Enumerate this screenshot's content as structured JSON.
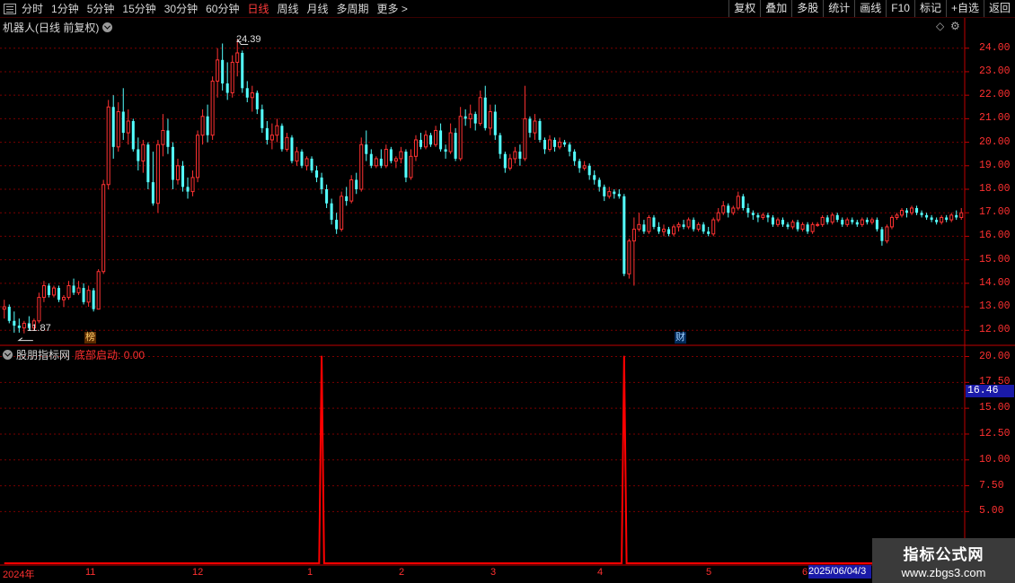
{
  "toolbar": {
    "tabs": [
      "分时",
      "1分钟",
      "5分钟",
      "15分钟",
      "30分钟",
      "60分钟",
      "日线",
      "周线",
      "月线",
      "多周期",
      "更多 >"
    ],
    "active_index": 6,
    "buttons": [
      "复权",
      "叠加",
      "多股",
      "统计",
      "画线",
      "F10",
      "标记",
      "+自选",
      "返回"
    ]
  },
  "main_panel": {
    "title": "机器人(日线 前复权)",
    "high_label": "24.39",
    "low_label": "11.87",
    "tag_bang": "榜",
    "tag_cai": "财",
    "axis_labels": [
      "24.00",
      "23.00",
      "22.00",
      "21.00",
      "20.00",
      "19.00",
      "18.00",
      "17.00",
      "16.00",
      "15.00",
      "14.00",
      "13.00",
      "12.00"
    ]
  },
  "indicator_panel": {
    "source": "股朋指标网",
    "indicator_name": "底部启动",
    "indicator_value": "0.00",
    "current_price_tag": "16.46",
    "axis_labels": [
      "20.00",
      "17.50",
      "15.00",
      "12.50",
      "10.00",
      "7.50",
      "5.00"
    ]
  },
  "date_axis": {
    "labels": [
      "2024年",
      "11",
      "12",
      "1",
      "2",
      "3",
      "4",
      "5",
      "6"
    ],
    "cursor_date": "2025/06/04/3"
  },
  "watermark": {
    "line1": "指标公式网",
    "line2": "www.zbgs3.com"
  },
  "colors": {
    "up": "#ff3232",
    "down": "#54ffff",
    "axis": "#c00000",
    "grid": "#7a0000",
    "signal": "#ff0000"
  },
  "chart_data": {
    "type": "candlestick",
    "price_range": [
      11.4,
      24.6
    ],
    "indicator_range": [
      0,
      21
    ],
    "signal_peaks": [
      {
        "position": "between 12 and 1",
        "value": 20
      },
      {
        "position": "between 4 and 5",
        "value": 20
      }
    ],
    "candles": [
      [
        12.9,
        13.3,
        12.5,
        13.0
      ],
      [
        13.0,
        13.1,
        12.3,
        12.4
      ],
      [
        12.4,
        12.8,
        11.9,
        12.2
      ],
      [
        12.2,
        12.5,
        11.9,
        12.1
      ],
      [
        12.1,
        12.4,
        11.87,
        12.3
      ],
      [
        12.3,
        12.6,
        12.0,
        12.1
      ],
      [
        12.1,
        12.5,
        12.0,
        12.4
      ],
      [
        12.4,
        13.6,
        12.3,
        13.4
      ],
      [
        13.4,
        14.1,
        13.2,
        13.9
      ],
      [
        13.9,
        14.0,
        13.4,
        13.5
      ],
      [
        13.5,
        13.9,
        13.4,
        13.8
      ],
      [
        13.8,
        13.9,
        13.2,
        13.3
      ],
      [
        13.3,
        13.5,
        13.0,
        13.4
      ],
      [
        13.4,
        14.1,
        13.3,
        13.9
      ],
      [
        13.9,
        14.2,
        13.5,
        13.6
      ],
      [
        13.6,
        14.1,
        13.5,
        13.8
      ],
      [
        13.8,
        14.0,
        13.1,
        13.2
      ],
      [
        13.2,
        13.9,
        13.0,
        13.7
      ],
      [
        13.7,
        13.8,
        12.8,
        12.9
      ],
      [
        12.9,
        14.6,
        12.9,
        14.5
      ],
      [
        14.5,
        18.4,
        14.4,
        18.2
      ],
      [
        18.2,
        21.8,
        18.0,
        21.5
      ],
      [
        21.5,
        22.0,
        19.3,
        19.8
      ],
      [
        19.8,
        21.7,
        19.6,
        21.3
      ],
      [
        21.3,
        22.3,
        20.1,
        20.4
      ],
      [
        20.4,
        21.4,
        19.9,
        20.9
      ],
      [
        20.9,
        21.0,
        19.6,
        19.7
      ],
      [
        19.7,
        20.2,
        18.8,
        19.2
      ],
      [
        19.2,
        20.1,
        18.7,
        19.9
      ],
      [
        19.9,
        20.0,
        18.0,
        18.3
      ],
      [
        18.3,
        19.6,
        17.3,
        17.4
      ],
      [
        17.4,
        20.1,
        17.0,
        19.9
      ],
      [
        19.9,
        21.2,
        19.4,
        20.5
      ],
      [
        20.5,
        21.0,
        19.5,
        19.8
      ],
      [
        19.8,
        20.0,
        18.0,
        18.4
      ],
      [
        18.4,
        19.3,
        18.2,
        19.0
      ],
      [
        19.0,
        19.2,
        17.9,
        18.1
      ],
      [
        18.1,
        18.5,
        17.6,
        17.9
      ],
      [
        17.9,
        18.8,
        17.7,
        18.5
      ],
      [
        18.5,
        20.5,
        18.3,
        20.3
      ],
      [
        20.3,
        21.4,
        19.9,
        21.1
      ],
      [
        21.1,
        21.6,
        20.0,
        20.3
      ],
      [
        20.3,
        22.8,
        20.1,
        22.6
      ],
      [
        22.6,
        24.0,
        21.9,
        23.5
      ],
      [
        23.5,
        24.2,
        22.2,
        22.5
      ],
      [
        22.5,
        23.4,
        21.8,
        22.1
      ],
      [
        22.1,
        23.7,
        21.9,
        23.4
      ],
      [
        23.4,
        24.39,
        22.8,
        23.8
      ],
      [
        23.8,
        23.9,
        22.1,
        22.3
      ],
      [
        22.3,
        22.6,
        21.7,
        21.9
      ],
      [
        21.9,
        22.4,
        21.3,
        22.1
      ],
      [
        22.1,
        22.2,
        21.2,
        21.4
      ],
      [
        21.4,
        21.6,
        20.4,
        20.6
      ],
      [
        20.6,
        20.9,
        19.9,
        20.1
      ],
      [
        20.1,
        20.8,
        19.7,
        20.3
      ],
      [
        20.3,
        21.0,
        20.0,
        20.7
      ],
      [
        20.7,
        20.8,
        19.6,
        19.7
      ],
      [
        19.7,
        20.4,
        19.6,
        20.2
      ],
      [
        20.2,
        20.3,
        19.1,
        19.2
      ],
      [
        19.2,
        19.8,
        19.0,
        19.6
      ],
      [
        19.6,
        19.7,
        18.9,
        19.0
      ],
      [
        19.0,
        19.4,
        18.8,
        19.3
      ],
      [
        19.3,
        19.4,
        18.7,
        18.8
      ],
      [
        18.8,
        19.0,
        18.3,
        18.5
      ],
      [
        18.5,
        18.7,
        17.8,
        18.0
      ],
      [
        18.0,
        18.2,
        17.2,
        17.4
      ],
      [
        17.4,
        17.6,
        16.5,
        16.7
      ],
      [
        16.7,
        17.0,
        16.1,
        16.3
      ],
      [
        16.3,
        17.9,
        16.2,
        17.7
      ],
      [
        17.7,
        18.1,
        17.3,
        17.5
      ],
      [
        17.5,
        18.6,
        17.4,
        18.4
      ],
      [
        18.4,
        18.7,
        17.8,
        18.0
      ],
      [
        18.0,
        20.2,
        17.9,
        19.9
      ],
      [
        19.9,
        20.5,
        19.2,
        19.5
      ],
      [
        19.5,
        19.7,
        18.9,
        19.0
      ],
      [
        19.0,
        19.4,
        18.9,
        19.3
      ],
      [
        19.3,
        19.7,
        18.9,
        19.0
      ],
      [
        19.0,
        19.9,
        18.9,
        19.7
      ],
      [
        19.7,
        19.8,
        19.1,
        19.2
      ],
      [
        19.2,
        19.4,
        18.9,
        19.3
      ],
      [
        19.3,
        19.8,
        19.1,
        19.6
      ],
      [
        19.6,
        19.7,
        18.3,
        18.5
      ],
      [
        18.5,
        19.7,
        18.4,
        19.4
      ],
      [
        19.4,
        20.3,
        19.2,
        20.1
      ],
      [
        20.1,
        20.4,
        19.7,
        19.8
      ],
      [
        19.8,
        20.5,
        19.7,
        20.3
      ],
      [
        20.3,
        20.4,
        19.8,
        19.9
      ],
      [
        19.9,
        20.7,
        19.8,
        20.5
      ],
      [
        20.5,
        20.8,
        19.6,
        19.7
      ],
      [
        19.7,
        19.9,
        19.3,
        19.6
      ],
      [
        19.6,
        20.8,
        19.5,
        20.4
      ],
      [
        20.4,
        20.6,
        19.2,
        19.3
      ],
      [
        19.3,
        21.5,
        19.2,
        21.1
      ],
      [
        21.1,
        21.4,
        20.7,
        21.0
      ],
      [
        21.0,
        21.6,
        20.6,
        21.2
      ],
      [
        21.2,
        21.3,
        20.5,
        20.8
      ],
      [
        20.8,
        22.2,
        20.7,
        21.9
      ],
      [
        21.9,
        22.4,
        20.5,
        20.6
      ],
      [
        20.6,
        21.6,
        20.3,
        21.3
      ],
      [
        21.3,
        21.6,
        20.1,
        20.3
      ],
      [
        20.3,
        20.4,
        19.3,
        19.5
      ],
      [
        19.5,
        19.6,
        18.7,
        18.9
      ],
      [
        18.9,
        19.5,
        18.8,
        19.3
      ],
      [
        19.3,
        19.8,
        19.1,
        19.6
      ],
      [
        19.6,
        19.9,
        19.0,
        19.3
      ],
      [
        19.3,
        22.4,
        19.2,
        21.0
      ],
      [
        21.0,
        21.1,
        20.2,
        20.4
      ],
      [
        20.4,
        21.2,
        20.1,
        20.9
      ],
      [
        20.9,
        21.0,
        20.0,
        20.1
      ],
      [
        20.1,
        20.2,
        19.5,
        19.7
      ],
      [
        19.7,
        20.3,
        19.6,
        20.1
      ],
      [
        20.1,
        20.2,
        19.6,
        19.8
      ],
      [
        19.8,
        20.2,
        19.7,
        20.0
      ],
      [
        20.0,
        20.1,
        19.8,
        19.9
      ],
      [
        19.9,
        20.0,
        19.4,
        19.6
      ],
      [
        19.6,
        19.7,
        19.0,
        19.2
      ],
      [
        19.2,
        19.3,
        18.7,
        18.9
      ],
      [
        18.9,
        19.2,
        18.8,
        19.0
      ],
      [
        19.0,
        19.1,
        18.4,
        18.6
      ],
      [
        18.6,
        18.8,
        18.2,
        18.4
      ],
      [
        18.4,
        18.5,
        17.9,
        18.1
      ],
      [
        18.1,
        18.2,
        17.5,
        17.7
      ],
      [
        17.7,
        18.1,
        17.6,
        17.9
      ],
      [
        17.9,
        18.0,
        17.6,
        17.8
      ],
      [
        17.8,
        18.0,
        17.6,
        17.7
      ],
      [
        17.7,
        17.8,
        14.3,
        14.4
      ],
      [
        14.4,
        15.9,
        14.2,
        15.8
      ],
      [
        15.8,
        16.8,
        13.9,
        16.3
      ],
      [
        16.3,
        17.0,
        16.2,
        16.5
      ],
      [
        16.5,
        16.7,
        16.1,
        16.2
      ],
      [
        16.2,
        16.9,
        16.1,
        16.8
      ],
      [
        16.8,
        16.9,
        16.3,
        16.4
      ],
      [
        16.4,
        16.6,
        16.1,
        16.2
      ],
      [
        16.2,
        16.5,
        16.0,
        16.3
      ],
      [
        16.3,
        16.4,
        16.0,
        16.1
      ],
      [
        16.1,
        16.5,
        16.0,
        16.4
      ],
      [
        16.4,
        16.6,
        16.2,
        16.5
      ],
      [
        16.5,
        16.7,
        16.3,
        16.4
      ],
      [
        16.4,
        16.8,
        16.3,
        16.7
      ],
      [
        16.7,
        16.8,
        16.2,
        16.3
      ],
      [
        16.3,
        16.6,
        16.2,
        16.5
      ],
      [
        16.5,
        16.6,
        16.1,
        16.2
      ],
      [
        16.2,
        16.4,
        16.0,
        16.1
      ],
      [
        16.1,
        16.8,
        16.0,
        16.7
      ],
      [
        16.7,
        17.2,
        16.6,
        17.0
      ],
      [
        17.0,
        17.5,
        16.9,
        17.3
      ],
      [
        17.3,
        17.4,
        16.8,
        17.0
      ],
      [
        17.0,
        17.3,
        16.9,
        17.2
      ],
      [
        17.2,
        17.9,
        17.1,
        17.7
      ],
      [
        17.7,
        17.8,
        17.1,
        17.2
      ],
      [
        17.2,
        17.4,
        16.8,
        17.0
      ],
      [
        17.0,
        17.1,
        16.7,
        16.9
      ],
      [
        16.9,
        17.0,
        16.6,
        16.8
      ],
      [
        16.8,
        17.0,
        16.7,
        16.9
      ],
      [
        16.9,
        17.0,
        16.6,
        16.8
      ],
      [
        16.8,
        16.9,
        16.4,
        16.5
      ],
      [
        16.5,
        16.8,
        16.4,
        16.7
      ],
      [
        16.7,
        16.8,
        16.4,
        16.5
      ],
      [
        16.5,
        16.6,
        16.3,
        16.4
      ],
      [
        16.4,
        16.7,
        16.3,
        16.6
      ],
      [
        16.6,
        16.7,
        16.2,
        16.3
      ],
      [
        16.3,
        16.6,
        16.2,
        16.5
      ],
      [
        16.5,
        16.6,
        16.1,
        16.2
      ],
      [
        16.2,
        16.6,
        16.1,
        16.5
      ],
      [
        16.5,
        16.6,
        16.4,
        16.5
      ],
      [
        16.5,
        16.9,
        16.4,
        16.8
      ],
      [
        16.8,
        16.9,
        16.5,
        16.6
      ],
      [
        16.6,
        17.0,
        16.5,
        16.9
      ],
      [
        16.9,
        17.0,
        16.6,
        16.7
      ],
      [
        16.7,
        16.8,
        16.4,
        16.5
      ],
      [
        16.5,
        16.8,
        16.4,
        16.7
      ],
      [
        16.7,
        16.8,
        16.5,
        16.6
      ],
      [
        16.6,
        16.7,
        16.4,
        16.5
      ],
      [
        16.5,
        16.8,
        16.4,
        16.7
      ],
      [
        16.7,
        16.8,
        16.5,
        16.6
      ],
      [
        16.6,
        16.8,
        16.5,
        16.7
      ],
      [
        16.7,
        16.8,
        16.2,
        16.3
      ],
      [
        16.3,
        16.4,
        15.6,
        15.8
      ],
      [
        15.8,
        16.5,
        15.7,
        16.4
      ],
      [
        16.4,
        16.9,
        16.3,
        16.8
      ],
      [
        16.8,
        17.0,
        16.7,
        16.9
      ],
      [
        16.9,
        17.2,
        16.8,
        17.1
      ],
      [
        17.1,
        17.2,
        16.8,
        17.0
      ],
      [
        17.0,
        17.3,
        16.9,
        17.2
      ],
      [
        17.2,
        17.3,
        16.9,
        17.0
      ],
      [
        17.0,
        17.1,
        16.8,
        16.9
      ],
      [
        16.9,
        17.0,
        16.7,
        16.8
      ],
      [
        16.8,
        16.9,
        16.6,
        16.7
      ],
      [
        16.7,
        16.8,
        16.5,
        16.6
      ],
      [
        16.6,
        16.9,
        16.5,
        16.8
      ],
      [
        16.8,
        16.9,
        16.6,
        16.7
      ],
      [
        16.7,
        17.0,
        16.6,
        16.9
      ],
      [
        16.9,
        17.1,
        16.7,
        16.8
      ],
      [
        16.8,
        17.2,
        16.7,
        17.0
      ]
    ]
  }
}
